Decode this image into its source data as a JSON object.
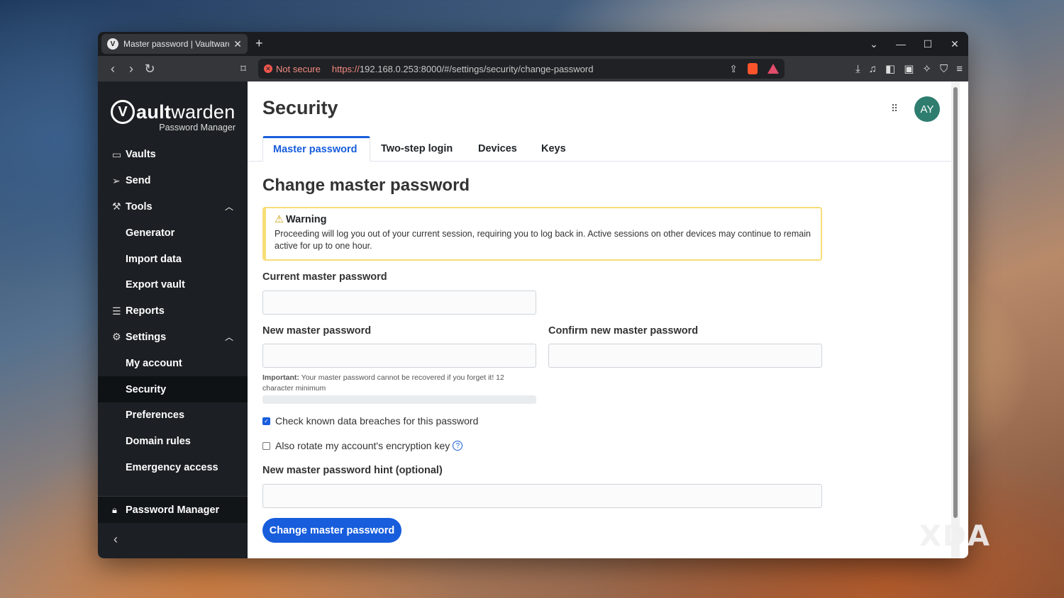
{
  "browser": {
    "tab_title": "Master password | Vaultwarden",
    "favicon_letter": "V",
    "not_secure": "Not secure",
    "url_scheme": "https://",
    "url_rest": "192.168.0.253:8000/#/settings/security/change-password"
  },
  "logo": {
    "bold": "ault",
    "rest": "warden",
    "letter": "V",
    "subtitle": "Password Manager"
  },
  "sidebar": {
    "items": [
      {
        "label": "Vaults",
        "icon": "vault-icon"
      },
      {
        "label": "Send",
        "icon": "send-icon"
      },
      {
        "label": "Tools",
        "icon": "tools-icon"
      },
      {
        "label": "Generator"
      },
      {
        "label": "Import data"
      },
      {
        "label": "Export vault"
      },
      {
        "label": "Reports",
        "icon": "reports-icon"
      },
      {
        "label": "Settings",
        "icon": "gear-icon"
      },
      {
        "label": "My account"
      },
      {
        "label": "Security"
      },
      {
        "label": "Preferences"
      },
      {
        "label": "Domain rules"
      },
      {
        "label": "Emergency access"
      }
    ],
    "footer": "Password Manager"
  },
  "header": {
    "title": "Security",
    "avatar": "AY"
  },
  "tabs": [
    "Master password",
    "Two-step login",
    "Devices",
    "Keys"
  ],
  "form": {
    "heading": "Change master password",
    "warning_title": "Warning",
    "warning_body": "Proceeding will log you out of your current session, requiring you to log back in. Active sessions on other devices may continue to remain active for up to one hour.",
    "current_label": "Current master password",
    "new_label": "New master password",
    "confirm_label": "Confirm new master password",
    "important_bold": "Important:",
    "important_text": " Your master password cannot be recovered if you forget it! 12 character minimum",
    "check_breach": "Check known data breaches for this password",
    "check_breach_checked": true,
    "rotate_key": "Also rotate my account's encryption key",
    "rotate_key_checked": false,
    "hint_label": "New master password hint (optional)",
    "submit": "Change master password"
  },
  "watermark": "XDA",
  "colors": {
    "accent": "#175ddc",
    "sidebar": "#1c2024",
    "warning_border": "#f8dd78",
    "avatar": "#2e7d6f"
  }
}
